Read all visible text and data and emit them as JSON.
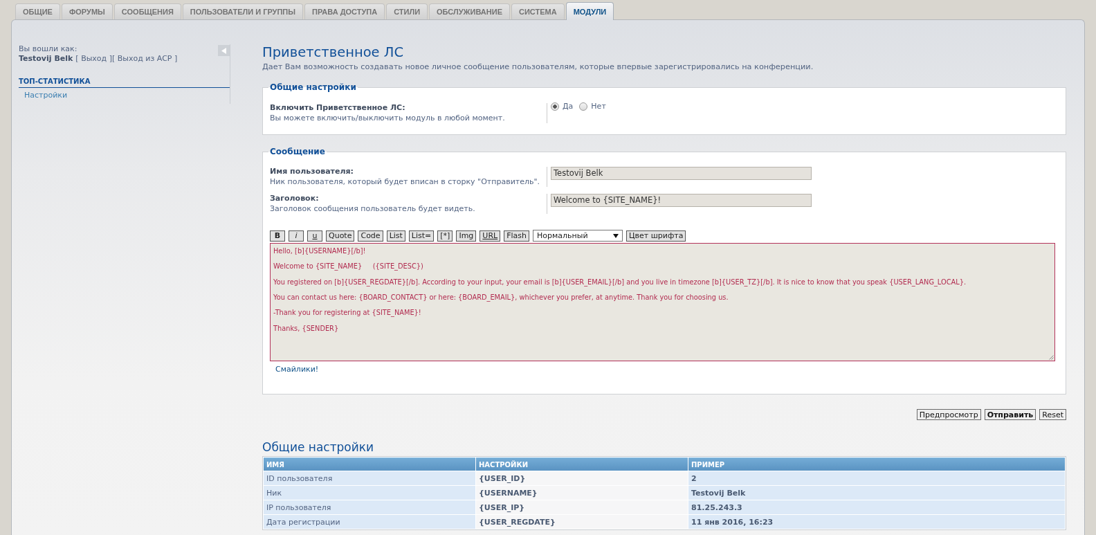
{
  "tabs": [
    {
      "label": "ОБЩИЕ",
      "selected": false
    },
    {
      "label": "ФОРУМЫ",
      "selected": false
    },
    {
      "label": "СООБЩЕНИЯ",
      "selected": false
    },
    {
      "label": "ПОЛЬЗОВАТЕЛИ И ГРУППЫ",
      "selected": false
    },
    {
      "label": "ПРАВА ДОСТУПА",
      "selected": false
    },
    {
      "label": "СТИЛИ",
      "selected": false
    },
    {
      "label": "ОБСЛУЖИВАНИЕ",
      "selected": false
    },
    {
      "label": "СИСТЕМА",
      "selected": false
    },
    {
      "label": "МОДУЛИ",
      "selected": true
    }
  ],
  "sidebar": {
    "logged_in_label": "Вы вошли как:",
    "username": "Testovij Belk",
    "links": [
      "[ Выход ]",
      "[ Выход из ACP ]"
    ],
    "menu": {
      "heading": "ТОП-СТАТИСТИКА",
      "items": [
        {
          "label": "Настройки",
          "selected": false
        }
      ]
    }
  },
  "page": {
    "title": "Приветственное ЛС",
    "description": "Дает Вам возможность создавать новое личное сообщение пользователям, которые впервые зарегистрировались на конференции."
  },
  "general_settings": {
    "legend": "Общие настройки",
    "rows": [
      {
        "label": "Включить Приветственное ЛС:",
        "explain": "Вы можете включить/выключить модуль в любой момент.",
        "options": [
          {
            "label": "Да",
            "selected": true
          },
          {
            "label": "Нет",
            "selected": false
          }
        ]
      }
    ]
  },
  "message": {
    "legend": "Сообщение",
    "fields": [
      {
        "label": "Имя пользователя:",
        "explain": "Ник пользователя, который будет вписан в сторку \"Отправитель\".",
        "value": "Testovij Belk"
      },
      {
        "label": "Заголовок:",
        "explain": "Заголовок сообщения пользователь будет видеть.",
        "value": "Welcome to {SITE_NAME}!"
      }
    ],
    "toolbar": [
      {
        "label": "B",
        "kind": "bold"
      },
      {
        "label": "i",
        "kind": "italic"
      },
      {
        "label": "u",
        "kind": "underline"
      },
      {
        "label": "Quote",
        "kind": "plain"
      },
      {
        "label": "Code",
        "kind": "plain"
      },
      {
        "label": "List",
        "kind": "plain"
      },
      {
        "label": "List=",
        "kind": "plain"
      },
      {
        "label": "[*]",
        "kind": "plain"
      },
      {
        "label": "Img",
        "kind": "plain"
      },
      {
        "label": "URL",
        "kind": "underline"
      },
      {
        "label": "Flash",
        "kind": "plain"
      },
      {
        "label": "Нормальный",
        "kind": "select"
      },
      {
        "label": "Цвет шрифта",
        "kind": "plain"
      }
    ],
    "body": [
      "Hello, [b]{USERNAME}[/b]!",
      "Welcome to {SITE_NAME}     ({SITE_DESC})",
      "You registered on [b]{USER_REGDATE}[/b]. According to your input, your email is [b]{USER_EMAIL}[/b] and you live in timezone [b]{USER_TZ}[/b]. It is nice to know that you speak {USER_LANG_LOCAL}.",
      "You can contact us here: {BOARD_CONTACT} or here: {BOARD_EMAIL}, whichever you prefer, at anytime. Thank you for choosing us.",
      "-Thank you for registering at {SITE_NAME}!",
      "Thanks, {SENDER}"
    ],
    "smilies_link": "Смайлики!"
  },
  "actions": [
    {
      "label": "Предпросмотр",
      "kind": "default"
    },
    {
      "label": "Отправить",
      "kind": "primary"
    },
    {
      "label": "Reset",
      "kind": "default"
    }
  ],
  "variables": {
    "title": "Общие настройки",
    "columns": [
      "ИМЯ",
      "НАСТРОЙКИ",
      "ПРИМЕР"
    ],
    "rows": [
      [
        "ID пользователя",
        "{USER_ID}",
        "2"
      ],
      [
        "Ник",
        "{USERNAME}",
        "Testovij Belk"
      ],
      [
        "IP пользователя",
        "{USER_IP}",
        "81.25.243.3"
      ],
      [
        "Дата регистрации",
        "{USER_REGDATE}",
        "11 янв 2016, 16:23"
      ]
    ]
  }
}
